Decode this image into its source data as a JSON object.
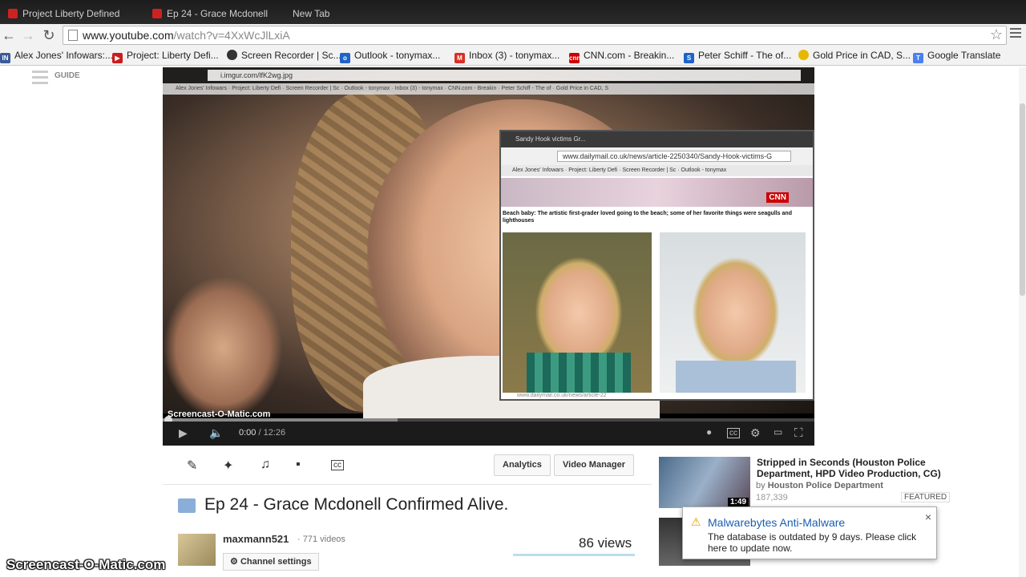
{
  "browser": {
    "tabs": [
      "Project Liberty Defined",
      "Ep 24 - Grace Mcdonell",
      "New Tab"
    ],
    "url_host": "www.youtube.com",
    "url_path": "/watch?v=4XxWcJlLxiA",
    "bookmarks": [
      {
        "label": "Alex Jones' Infowars:...",
        "icon": "infowars-icon",
        "color": "#3a5a9a"
      },
      {
        "label": "Project: Liberty Defi...",
        "icon": "youtube-icon",
        "color": "#cc1b1b"
      },
      {
        "label": "Screen Recorder | Sc...",
        "icon": "screencast-icon",
        "color": "#333333"
      },
      {
        "label": "Outlook - tonymax...",
        "icon": "outlook-icon",
        "color": "#1e63c8"
      },
      {
        "label": "Inbox (3) - tonymax...",
        "icon": "gmail-icon",
        "color": "#d93025"
      },
      {
        "label": "CNN.com - Breakin...",
        "icon": "cnn-icon",
        "color": "#cc0000"
      },
      {
        "label": "Peter Schiff - The of...",
        "icon": "s-icon",
        "color": "#1e63c8"
      },
      {
        "label": "Gold Price in CAD, S...",
        "icon": "gold-icon",
        "color": "#e6b800"
      },
      {
        "label": "Google Translate",
        "icon": "translate-icon",
        "color": "#4a80f0"
      }
    ]
  },
  "guide": {
    "label": "GUIDE"
  },
  "video": {
    "inner_url": "i.imgur.com/lfK2wg.jpg",
    "inner_bookmarks": "Alex Jones' Infowars  ·  Project: Liberty Defi  ·  Screen Recorder | Sc  ·  Outlook - tonymax  ·  Inbox (3) - tonymax  ·  CNN.com - Breakin  ·  Peter Schiff - The of  ·  Gold Price in CAD, S",
    "nested": {
      "tab_title": "Sandy Hook victims Gr...",
      "url": "www.dailymail.co.uk/news/article-2250340/Sandy-Hook-victims-G",
      "bookmarks": "Alex Jones' Infowars  ·  Project: Liberty Defi  ·  Screen Recorder | Sc  ·  Outlook - tonymax",
      "logo": "CNN",
      "caption": "Beach baby: The artistic first-grader loved going to the beach; some of her favorite things were seagulls and lighthouses",
      "status": "www.dailymail.co.uk/news/article-22"
    },
    "watermark": "Screencast-O-Matic.com",
    "time_current": "0:00",
    "time_total": "/ 12:26",
    "progress_loaded": 0.36
  },
  "actions": {
    "analytics": "Analytics",
    "video_manager": "Video Manager"
  },
  "title": "Ep 24 - Grace Mcdonell Confirmed Alive.",
  "owner": {
    "name": "maxmann521",
    "videos": "· 771 videos",
    "settings": "Channel settings"
  },
  "views": "86 views",
  "sidebar": {
    "title": "Stripped in Seconds (Houston Police Department, HPD Video Production, CG)",
    "by_prefix": "by",
    "channel": "Houston Police Department",
    "views": "187,339",
    "badge": "FEATURED",
    "duration": "1:49"
  },
  "notification": {
    "title": "Malwarebytes Anti-Malware",
    "body": "The database is outdated by 9 days. Please click here to update now.",
    "close": "×"
  },
  "watermark": "Screencast-O-Matic.com"
}
